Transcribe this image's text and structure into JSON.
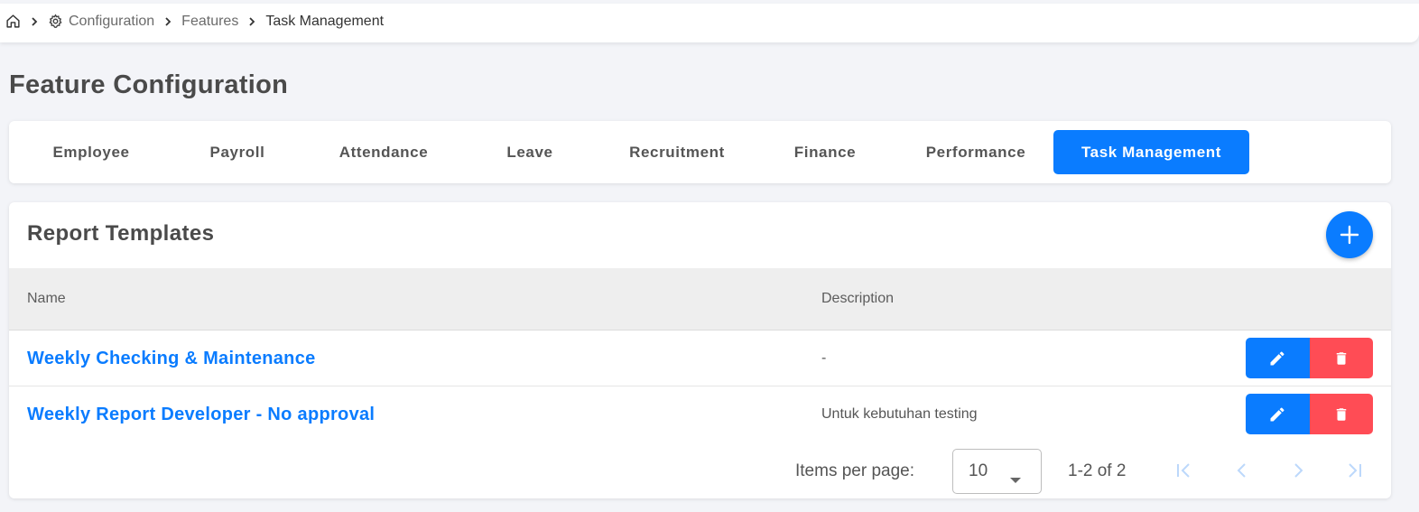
{
  "breadcrumb": {
    "items": [
      "Configuration",
      "Features",
      "Task Management"
    ]
  },
  "page": {
    "title": "Feature Configuration"
  },
  "tabs": [
    {
      "label": "Employee",
      "active": false
    },
    {
      "label": "Payroll",
      "active": false
    },
    {
      "label": "Attendance",
      "active": false
    },
    {
      "label": "Leave",
      "active": false
    },
    {
      "label": "Recruitment",
      "active": false
    },
    {
      "label": "Finance",
      "active": false
    },
    {
      "label": "Performance",
      "active": false
    },
    {
      "label": "Task Management",
      "active": true
    }
  ],
  "report_templates": {
    "title": "Report Templates",
    "columns": {
      "name": "Name",
      "description": "Description"
    },
    "rows": [
      {
        "name": "Weekly Checking & Maintenance",
        "description": "-"
      },
      {
        "name": "Weekly Report Developer - No approval",
        "description": "Untuk kebutuhan testing"
      }
    ]
  },
  "pagination": {
    "items_per_page_label": "Items per page:",
    "items_per_page_value": "10",
    "range": "1-2 of 2"
  },
  "colors": {
    "primary": "#0a7cff",
    "danger": "#ff4c55",
    "background": "#f3f4f8"
  }
}
